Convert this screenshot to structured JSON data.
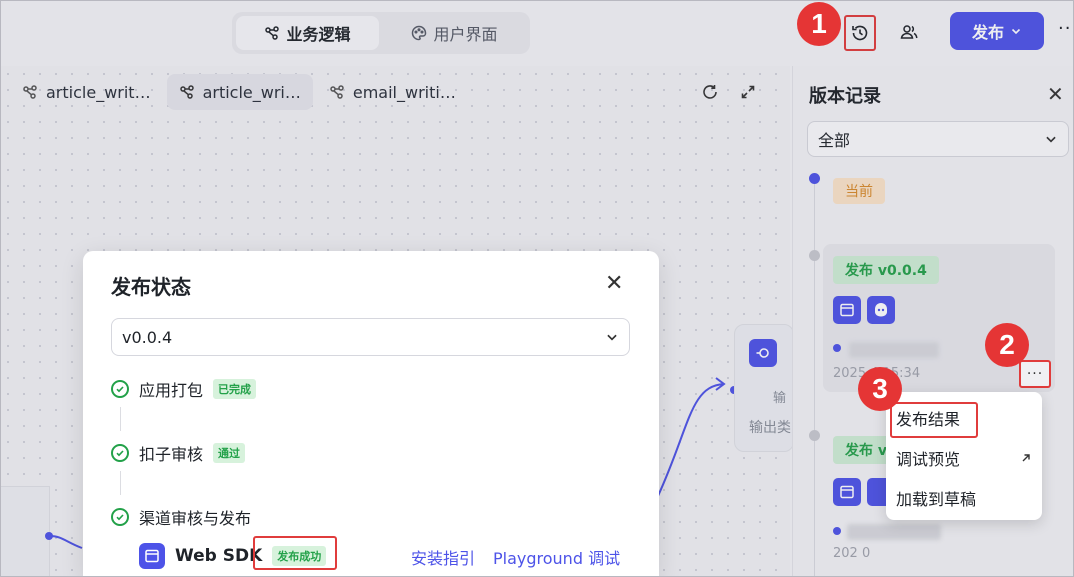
{
  "topbar": {
    "tabs": [
      {
        "label": "业务逻辑",
        "icon": "workflow-icon",
        "active": true
      },
      {
        "label": "用户界面",
        "icon": "palette-icon",
        "active": false
      }
    ],
    "publish_label": "发布",
    "more_label": "···"
  },
  "workflow_tabs": [
    {
      "label": "article_writ…",
      "active": false
    },
    {
      "label": "article_wri…",
      "active": true
    },
    {
      "label": "email_writi…",
      "active": false
    }
  ],
  "canvas": {
    "node_text1": "输",
    "node_text2": "输出类"
  },
  "version_panel": {
    "title": "版本记录",
    "filter_value": "全部",
    "current_tag": "当前",
    "versions": [
      {
        "tag": "发布 v0.0.4",
        "time": "2025 4 15:34"
      },
      {
        "tag": "发布 v",
        "time": "202 0"
      }
    ]
  },
  "context_menu": {
    "items": [
      "发布结果",
      "调试预览",
      "加载到草稿"
    ]
  },
  "dialog": {
    "title": "发布状态",
    "version_value": "v0.0.4",
    "steps": [
      {
        "label": "应用打包",
        "tag": "已完成"
      },
      {
        "label": "扣子审核",
        "tag": "通过"
      },
      {
        "label": "渠道审核与发布",
        "tag": ""
      }
    ],
    "channel": {
      "name": "Web SDK",
      "status": "发布成功",
      "guide_link": "安装指引",
      "playground_link": "Playground 调试"
    }
  },
  "callouts": [
    "1",
    "2",
    "3"
  ],
  "colors": {
    "accent": "#4d53e8",
    "success": "#23a149",
    "warning": "#d98b2b",
    "callout": "#e53535"
  }
}
